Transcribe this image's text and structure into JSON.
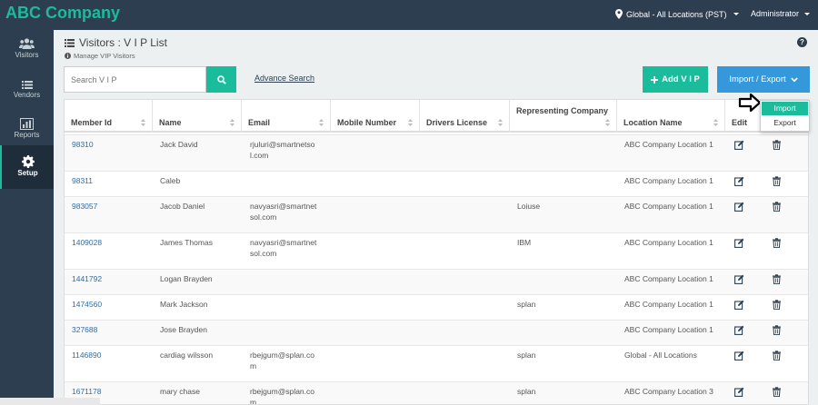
{
  "app": {
    "brand": "ABC Company"
  },
  "topbar": {
    "location": "Global - All Locations (PST)",
    "user": "Administrator"
  },
  "sidebar": {
    "items": [
      {
        "label": "Visitors",
        "icon": "users-icon"
      },
      {
        "label": "Vendors",
        "icon": "list-icon"
      },
      {
        "label": "Reports",
        "icon": "bar-chart-icon"
      },
      {
        "label": "Setup",
        "icon": "gear-icon",
        "active": true
      }
    ]
  },
  "page": {
    "title": "Visitors : V I P List",
    "subtitle": "Manage VIP Visitors"
  },
  "search": {
    "placeholder": "Search V I P",
    "advance_label": "Advance Search"
  },
  "actions": {
    "add_label": "Add V I P",
    "import_export_label": "Import / Export"
  },
  "dropdown": {
    "items": [
      "Import",
      "Export"
    ],
    "selected": "Import"
  },
  "table": {
    "columns": [
      "Member Id",
      "Name",
      "Email",
      "Mobile Number",
      "Drivers License",
      "Representing Company",
      "Location Name",
      "Edit",
      ""
    ],
    "rows": [
      {
        "member_id": "98310",
        "name": "Jack David",
        "email_1": "rjuluri@smartnetso",
        "email_2": "l.com",
        "mobile": "",
        "license": "",
        "company": "",
        "location": "ABC Company Location 1"
      },
      {
        "member_id": "98311",
        "name": "Caleb",
        "email_1": "",
        "email_2": "",
        "mobile": "",
        "license": "",
        "company": "",
        "location": "ABC Company Location 1"
      },
      {
        "member_id": "983057",
        "name": "Jacob Daniel",
        "email_1": "navyasri@smartnet",
        "email_2": "sol.com",
        "mobile": "",
        "license": "",
        "company": "Loiuse",
        "location": "ABC Company Location 1"
      },
      {
        "member_id": "1409028",
        "name": "James Thomas",
        "email_1": "navyasri@smartnet",
        "email_2": "sol.com",
        "mobile": "",
        "license": "",
        "company": "IBM",
        "location": "ABC Company Location 1"
      },
      {
        "member_id": "1441792",
        "name": "Logan Brayden",
        "email_1": "",
        "email_2": "",
        "mobile": "",
        "license": "",
        "company": "",
        "location": "ABC Company Location 1"
      },
      {
        "member_id": "1474560",
        "name": "Mark Jackson",
        "email_1": "",
        "email_2": "",
        "mobile": "",
        "license": "",
        "company": "splan",
        "location": "ABC Company Location 1"
      },
      {
        "member_id": "327688",
        "name": "Jose Brayden",
        "email_1": "",
        "email_2": "",
        "mobile": "",
        "license": "",
        "company": "",
        "location": "ABC Company Location 1"
      },
      {
        "member_id": "1146890",
        "name": "cardiag wilsson",
        "email_1": "rbejgum@splan.co",
        "email_2": "m",
        "mobile": "",
        "license": "",
        "company": "splan",
        "location": "Global - All Locations"
      },
      {
        "member_id": "1671178",
        "name": "mary chase",
        "email_1": "rbejgum@splan.co",
        "email_2": "m",
        "mobile": "",
        "license": "",
        "company": "splan",
        "location": "ABC Company Location 3"
      }
    ]
  },
  "colors": {
    "accent": "#1abc9c",
    "nav": "#2c3e50",
    "primary": "#3498db"
  }
}
